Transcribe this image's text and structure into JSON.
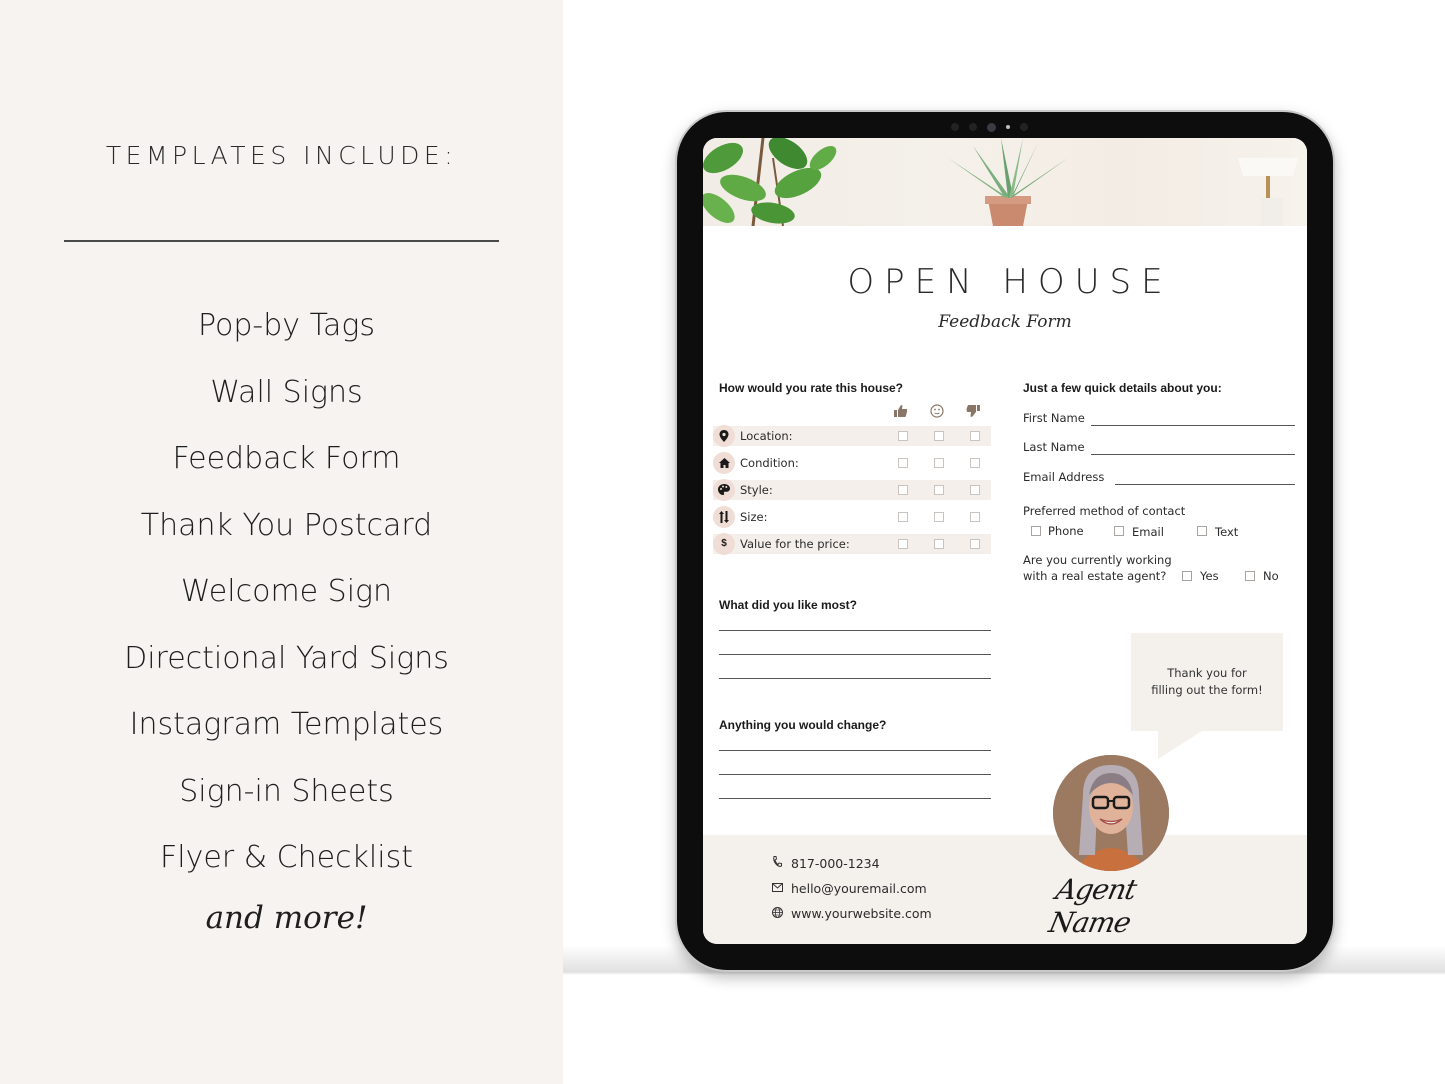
{
  "left_panel": {
    "heading": "TEMPLATES INCLUDE:",
    "items": [
      "Pop-by Tags",
      "Wall Signs",
      "Feedback Form",
      "Thank You Postcard",
      "Welcome Sign",
      "Directional Yard Signs",
      "Instagram Templates",
      "Sign-in Sheets",
      "Flyer & Checklist"
    ],
    "footer_text": "and more!"
  },
  "form": {
    "title": "OPEN HOUSE",
    "subtitle": "Feedback Form",
    "rating": {
      "heading": "How would you rate this house?",
      "columns": [
        {
          "icon": "thumbs-up-icon",
          "glyph": "👍"
        },
        {
          "icon": "neutral-face-icon",
          "glyph": "☺"
        },
        {
          "icon": "thumbs-down-icon",
          "glyph": "👎"
        }
      ],
      "rows": [
        {
          "label": "Location:",
          "icon": "map-pin-icon",
          "glyph": "●"
        },
        {
          "label": "Condition:",
          "icon": "home-icon",
          "glyph": "⌂"
        },
        {
          "label": "Style:",
          "icon": "palette-icon",
          "glyph": "◕"
        },
        {
          "label": "Size:",
          "icon": "sort-arrows-icon",
          "glyph": "⇅"
        },
        {
          "label": "Value for the price:",
          "icon": "dollar-icon",
          "glyph": "$"
        }
      ]
    },
    "liked_most": {
      "heading": "What did you like most?"
    },
    "would_change": {
      "heading": "Anything you would change?"
    },
    "details": {
      "heading": "Just a few quick details about you:",
      "first_name_label": "First Name",
      "last_name_label": "Last Name",
      "email_label": "Email Address",
      "contact_method_label": "Preferred method of contact",
      "contact_options": [
        "Phone",
        "Email",
        "Text"
      ],
      "agent_question_line1": "Are you currently working",
      "agent_question_line2": "with a real estate agent?",
      "agent_options": [
        "Yes",
        "No"
      ]
    },
    "thank_you_line1": "Thank you for",
    "thank_you_line2": "filling out the form!",
    "footer": {
      "phone": "817-000-1234",
      "email": "hello@youremail.com",
      "website": "www.yourwebsite.com",
      "agent_name": "Agent Name"
    }
  },
  "colors": {
    "left_bg": "#f6f3f0",
    "accent_pink": "#f0ddd6",
    "row_shade": "#f5efeb",
    "footer_bg": "#f4f1ed",
    "icon_brown": "#8a7666"
  }
}
